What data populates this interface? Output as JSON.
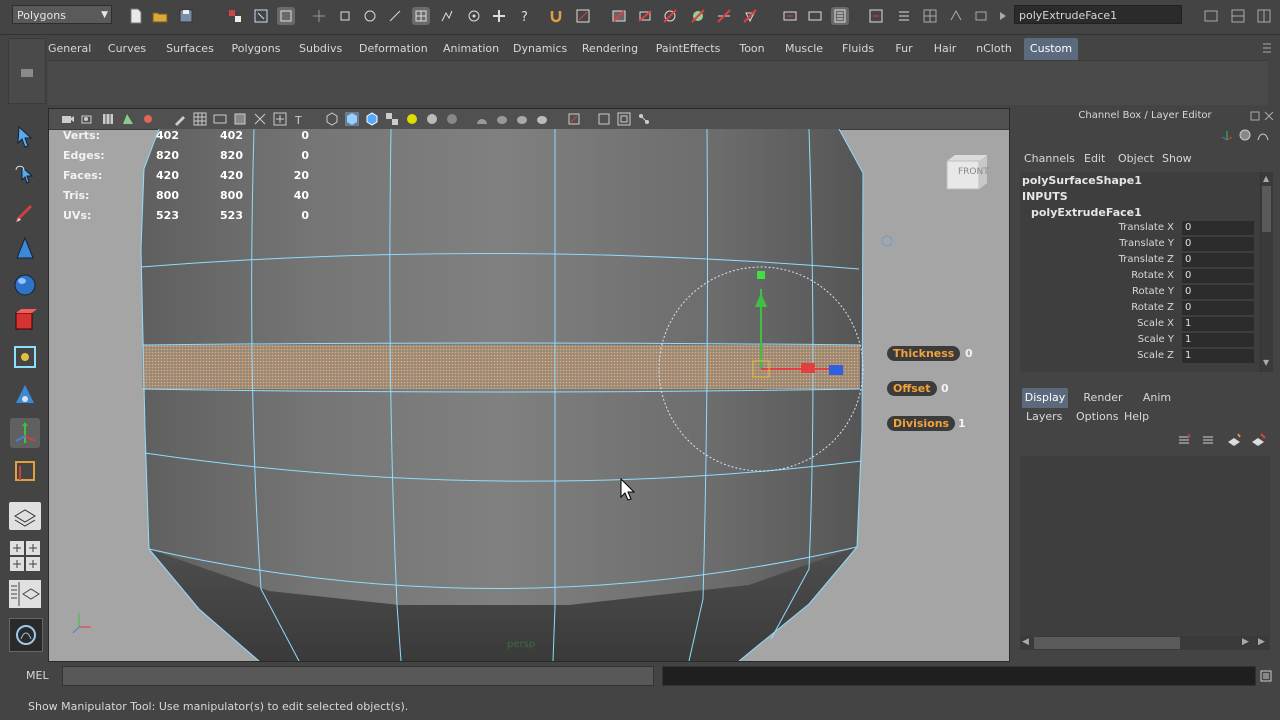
{
  "status_line": {
    "mode": "Polygons",
    "tool_name_field": "polyExtrudeFace1"
  },
  "shelf": {
    "tabs": [
      "General",
      "Curves",
      "Surfaces",
      "Polygons",
      "Subdivs",
      "Deformation",
      "Animation",
      "Dynamics",
      "Rendering",
      "PaintEffects",
      "Toon",
      "Muscle",
      "Fluids",
      "Fur",
      "Hair",
      "nCloth",
      "Custom"
    ],
    "active_tab": "Custom"
  },
  "viewport": {
    "camera": "persp",
    "view_cube": "FRONT",
    "hud": {
      "rows": [
        {
          "label": "Verts:",
          "a": "402",
          "b": "402",
          "c": "0"
        },
        {
          "label": "Edges:",
          "a": "820",
          "b": "820",
          "c": "0"
        },
        {
          "label": "Faces:",
          "a": "420",
          "b": "420",
          "c": "20"
        },
        {
          "label": "Tris:",
          "a": "800",
          "b": "800",
          "c": "40"
        },
        {
          "label": "UVs:",
          "a": "523",
          "b": "523",
          "c": "0"
        }
      ]
    },
    "in_view_editor": [
      {
        "label": "Thickness",
        "value": "0"
      },
      {
        "label": "Offset",
        "value": "0"
      },
      {
        "label": "Divisions",
        "value": "1"
      }
    ]
  },
  "channel_box": {
    "title": "Channel Box / Layer Editor",
    "menus": [
      "Channels",
      "Edit",
      "Object",
      "Show"
    ],
    "shape_node": "polySurfaceShape1",
    "inputs_header": "INPUTS",
    "input_node": "polyExtrudeFace1",
    "attributes": [
      {
        "name": "Translate X",
        "value": "0"
      },
      {
        "name": "Translate Y",
        "value": "0"
      },
      {
        "name": "Translate Z",
        "value": "0"
      },
      {
        "name": "Rotate X",
        "value": "0"
      },
      {
        "name": "Rotate Y",
        "value": "0"
      },
      {
        "name": "Rotate Z",
        "value": "0"
      },
      {
        "name": "Scale X",
        "value": "1"
      },
      {
        "name": "Scale Y",
        "value": "1"
      },
      {
        "name": "Scale Z",
        "value": "1"
      }
    ]
  },
  "layer_editor": {
    "tabs": [
      "Display",
      "Render",
      "Anim"
    ],
    "active_tab": "Display",
    "menus": [
      "Layers",
      "Options",
      "Help"
    ]
  },
  "command_line": {
    "label": "MEL"
  },
  "help_line": {
    "text": "Show Manipulator Tool: Use manipulator(s) to edit selected object(s)."
  },
  "colors": {
    "wireframe": "#8fdcff",
    "selected_faces": "#e8b27a",
    "accent_tab": "#5b6b7d",
    "ih_label": "#f2a23c"
  }
}
